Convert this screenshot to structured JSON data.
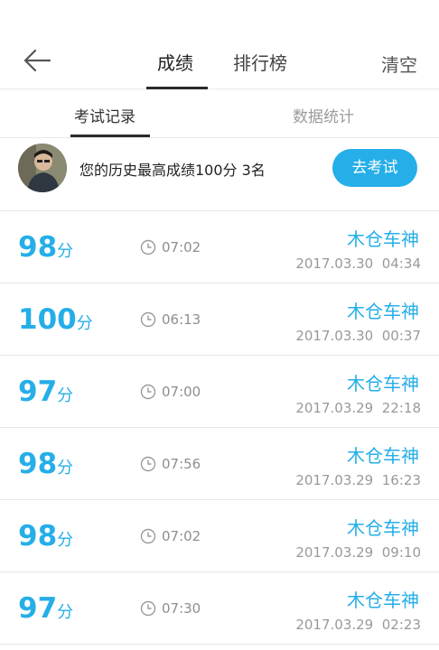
{
  "header": {
    "tabs": [
      {
        "label": "成绩"
      },
      {
        "label": "排行榜"
      }
    ],
    "clear_label": "清空",
    "back_icon": "back-arrow-icon"
  },
  "subtabs": [
    {
      "label": "考试记录"
    },
    {
      "label": "数据统计"
    }
  ],
  "profile": {
    "best_text": "您的历史最高成绩100分  3名",
    "go_exam_label": "去考试"
  },
  "records": [
    {
      "score": "98",
      "unit": "分",
      "duration": "07:02",
      "user": "木仓车神",
      "datetime": "2017.03.30  04:34"
    },
    {
      "score": "100",
      "unit": "分",
      "duration": "06:13",
      "user": "木仓车神",
      "datetime": "2017.03.30  00:37"
    },
    {
      "score": "97",
      "unit": "分",
      "duration": "07:00",
      "user": "木仓车神",
      "datetime": "2017.03.29  22:18"
    },
    {
      "score": "98",
      "unit": "分",
      "duration": "07:56",
      "user": "木仓车神",
      "datetime": "2017.03.29  16:23"
    },
    {
      "score": "98",
      "unit": "分",
      "duration": "07:02",
      "user": "木仓车神",
      "datetime": "2017.03.29  09:10"
    },
    {
      "score": "97",
      "unit": "分",
      "duration": "07:30",
      "user": "木仓车神",
      "datetime": "2017.03.29  02:23"
    }
  ],
  "colors": {
    "accent": "#25aee8",
    "text": "#222222",
    "muted": "#999999",
    "divider": "#e6e6e6"
  }
}
